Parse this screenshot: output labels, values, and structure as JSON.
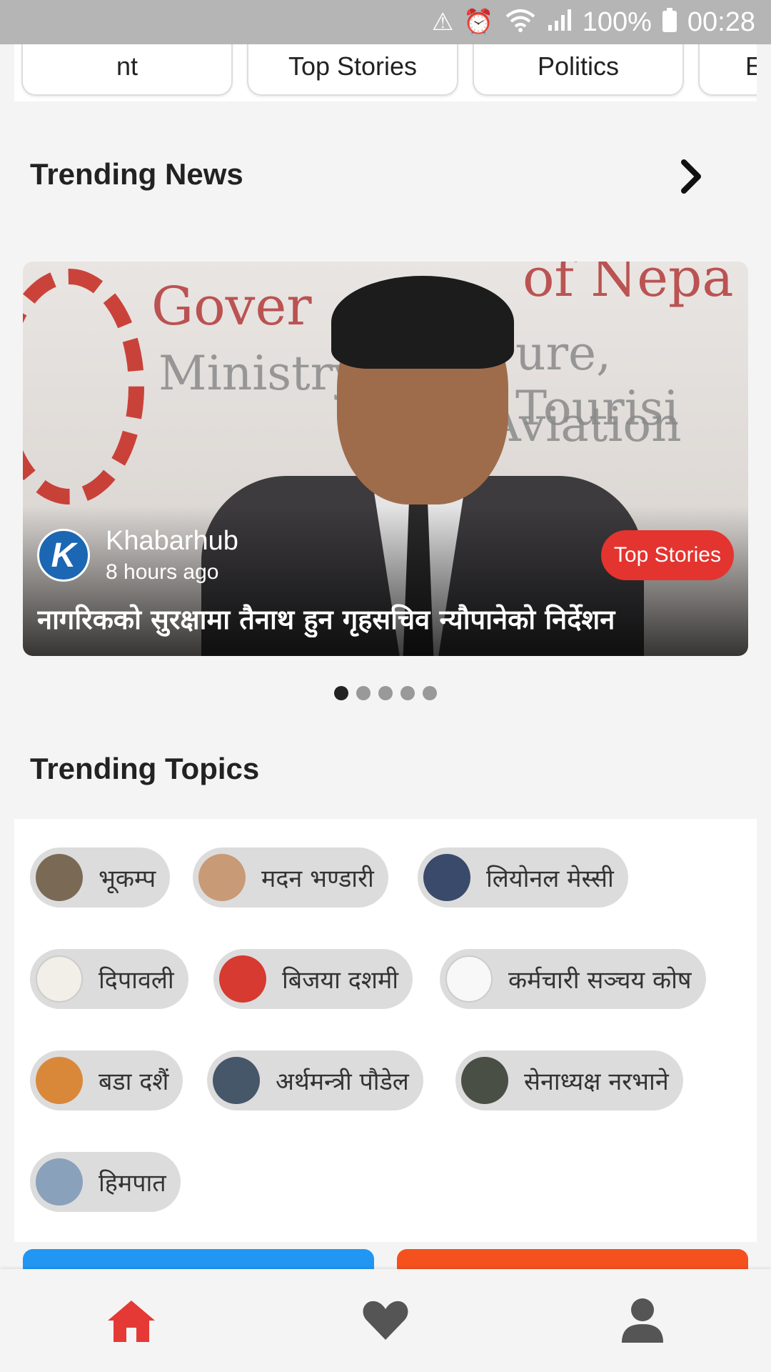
{
  "status_bar": {
    "battery": "100%",
    "time": "00:28"
  },
  "categories": [
    "nt",
    "Top Stories",
    "Politics",
    "E"
  ],
  "trending_news": {
    "title": "Trending News",
    "card": {
      "source": "Khabarhub",
      "time_ago": "8 hours ago",
      "category_badge": "Top Stories",
      "headline": "नागरिकको सुरक्षामा तैनाथ हुन गृहसचिव न्यौपानेको निर्देशन",
      "photo_text": {
        "line1": "Gover",
        "line1b": "of Nepa",
        "line2": "Ministry",
        "line2b": "ure, Tourisi",
        "line3": "Aviation"
      }
    },
    "carousel_pages": 5,
    "active_page": 1
  },
  "trending_topics": {
    "title": "Trending Topics",
    "chips": [
      {
        "label": "भूकम्प",
        "avatar_color": "#7a6a55"
      },
      {
        "label": "मदन भण्डारी",
        "avatar_color": "#c99a76"
      },
      {
        "label": "लियोनल मेस्सी",
        "avatar_color": "#3a4a6a"
      },
      {
        "label": "दिपावली",
        "avatar_color": "#f2efe8"
      },
      {
        "label": "बिजया दशमी",
        "avatar_color": "#d63a30"
      },
      {
        "label": "कर्मचारी सञ्चय कोष",
        "avatar_color": "#f8f8f8"
      },
      {
        "label": "बडा दशैं",
        "avatar_color": "#d9883a"
      },
      {
        "label": "अर्थमन्त्री पौडेल",
        "avatar_color": "#46576a"
      },
      {
        "label": "सेनाध्यक्ष नरभाने",
        "avatar_color": "#4a4f45"
      },
      {
        "label": "हिमपात",
        "avatar_color": "#8aa1bb"
      }
    ]
  },
  "bottom_buttons": {
    "left_color": "#2196f3",
    "right_color": "#f4511e"
  },
  "bottom_nav": {
    "items": [
      {
        "icon": "home-icon",
        "active": true
      },
      {
        "icon": "heart-icon",
        "active": false
      },
      {
        "icon": "profile-icon",
        "active": false
      }
    ],
    "active_color": "#e53935",
    "inactive_color": "#555555"
  }
}
